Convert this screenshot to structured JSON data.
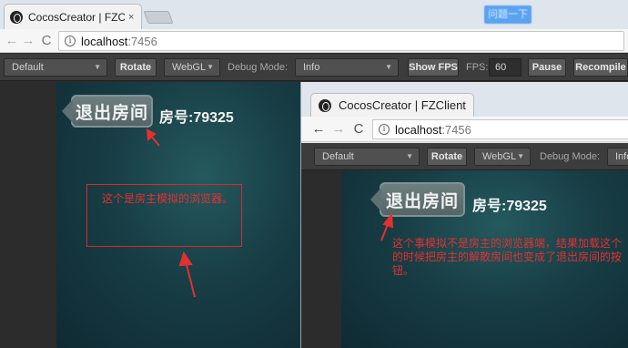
{
  "browser": {
    "tab_title": "CocosCreator | FZClient",
    "tab_close": "×",
    "blurred_button": "问题一下",
    "url_host": "localhost",
    "url_port": ":7456",
    "back": "←",
    "forward": "→",
    "reload": "C"
  },
  "toolbar": {
    "device": "Default",
    "rotate": "Rotate",
    "renderer": "WebGL",
    "debug_mode_label": "Debug Mode:",
    "debug_mode_value": "Info",
    "show_fps": "Show FPS",
    "fps_label": "FPS:",
    "fps_value": "60",
    "pause": "Pause",
    "recompile": "Recompile"
  },
  "game_left": {
    "exit_button": "退出房间",
    "room_number": "房号:79325",
    "annotation": "这个是房主模拟的浏览器。"
  },
  "window2": {
    "tab_title": "CocosCreator | FZClient",
    "url_host": "localhost",
    "url_port": ":7456",
    "toolbar": {
      "device": "Default",
      "rotate": "Rotate",
      "renderer": "WebGL",
      "debug_mode_label": "Debug Mode:",
      "debug_mode_value": "Info"
    },
    "game": {
      "exit_button": "退出房间",
      "room_number": "房号:79325",
      "annotation": "这个事模拟不是房主的浏览器端，结果加载这个的时候把房主的解散房间也变成了退出房间的按钮。"
    }
  },
  "colors": {
    "annotation_red": "#e53030",
    "canvas_teal": "#183d45",
    "toolbar_dark": "#3c3c3c"
  }
}
